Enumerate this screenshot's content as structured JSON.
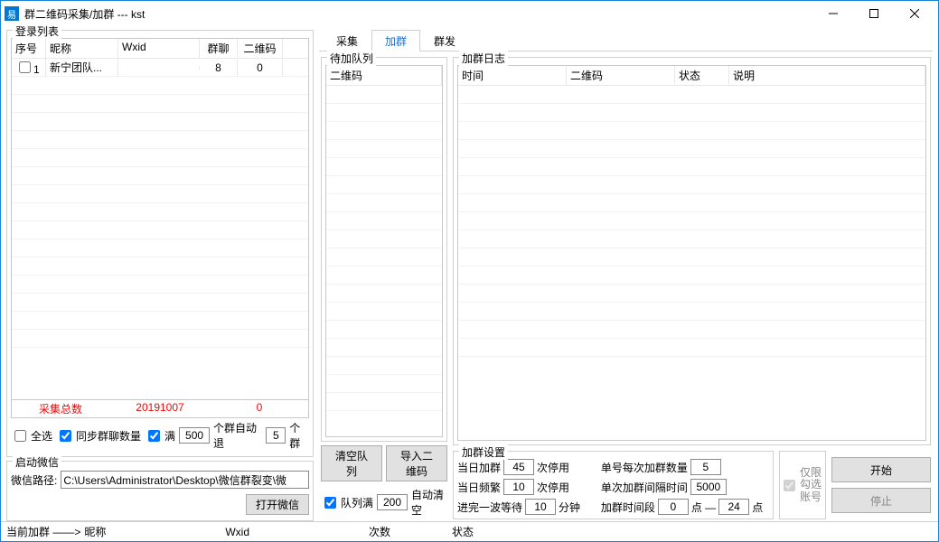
{
  "window": {
    "title": "群二维码采集/加群   --- kst"
  },
  "login": {
    "title": "登录列表",
    "headers": {
      "seq": "序号",
      "nick": "昵称",
      "wxid": "Wxid",
      "gc": "群聊",
      "qr": "二维码"
    },
    "rows": [
      {
        "seq": "1",
        "nick": "新宁团队...",
        "wxid": "",
        "gc": "8",
        "qr": "0"
      }
    ],
    "foot": {
      "total_label": "采集总数",
      "date": "20191007",
      "count": "0"
    },
    "opts": {
      "select_all": "全选",
      "sync_gc": "同步群聊数量",
      "full_prefix": "满",
      "full_value": "500",
      "full_suffix": "个群自动退",
      "exit_value": "5",
      "exit_suffix": "个群"
    }
  },
  "wx": {
    "title": "启动微信",
    "path_label": "微信路径:",
    "path_value": "C:\\Users\\Administrator\\Desktop\\微信群裂变\\微",
    "open_btn": "打开微信"
  },
  "tabs": {
    "collect": "采集",
    "join": "加群",
    "mass": "群发"
  },
  "queue": {
    "title": "待加队列",
    "header": "二维码",
    "clear_btn": "清空队列",
    "import_btn": "导入二维码",
    "auto_prefix": "队列满",
    "auto_value": "200",
    "auto_suffix": "自动清空"
  },
  "log": {
    "title": "加群日志",
    "headers": {
      "time": "时间",
      "qr": "二维码",
      "status": "状态",
      "desc": "说明"
    }
  },
  "settings": {
    "title": "加群设置",
    "daily_join_pre": "当日加群",
    "daily_join_val": "45",
    "daily_join_suf": "次停用",
    "per_acc_pre": "单号每次加群数量",
    "per_acc_val": "5",
    "daily_freq_pre": "当日频繁",
    "daily_freq_val": "10",
    "daily_freq_suf": "次停用",
    "interval_pre": "单次加群间隔时间",
    "interval_val": "5000",
    "wave_pre": "进完一波等待",
    "wave_val": "10",
    "wave_suf": "分钟",
    "period_pre": "加群时间段",
    "period_from": "0",
    "period_mid": "点 —",
    "period_to": "24",
    "period_end": "点",
    "only_checked": "仅限勾选账号"
  },
  "actions": {
    "start": "开始",
    "stop": "停止"
  },
  "status": {
    "prefix": "当前加群 ——>",
    "nick_label": "昵称",
    "wxid_label": "Wxid",
    "count_label": "次数",
    "state_label": "状态"
  }
}
